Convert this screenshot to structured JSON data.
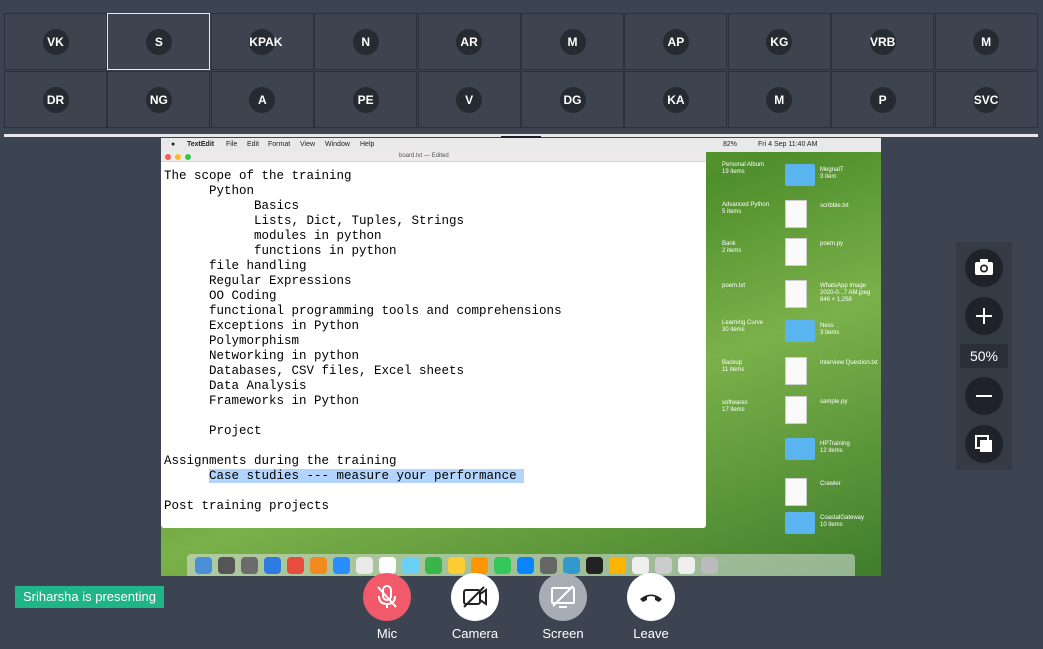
{
  "participants": {
    "row1": [
      "VK",
      "S",
      "KPAK",
      "N",
      "AR",
      "M",
      "AP",
      "KG",
      "VRB",
      "M"
    ],
    "row2": [
      "DR",
      "NG",
      "A",
      "PE",
      "V",
      "DG",
      "KA",
      "M",
      "P",
      "SVC"
    ],
    "active_index": 1
  },
  "shared_screen": {
    "menubar": {
      "app": "TextEdit",
      "menus": [
        "File",
        "Edit",
        "Format",
        "View",
        "Window",
        "Help"
      ],
      "battery": "82%",
      "datetime": "Fri 4 Sep  11:40 AM"
    },
    "editor": {
      "title": "board.txt",
      "title_suffix": "— Edited",
      "lines_before": "The scope of the training\n      Python\n            Basics\n            Lists, Dict, Tuples, Strings\n            modules in python\n            functions in python\n      file handling\n      Regular Expressions\n      OO Coding\n      functional programming tools and comprehensions\n      Exceptions in Python\n      Polymorphism\n      Networking in python\n      Databases, CSV files, Excel sheets\n      Data Analysis\n      Frameworks in Python\n\n      Project\n\nAssignments during the training\n      ",
      "highlighted": "Case studies --- measure your performance ",
      "lines_after": "\n\nPost training projects"
    },
    "desktop_items": [
      {
        "label": "Personal Album",
        "sub": "19 items"
      },
      {
        "label": "MegnaIT",
        "sub": "3 item"
      },
      {
        "label": "Advanced Python",
        "sub": "5 items"
      },
      {
        "label": "scribble.txt",
        "sub": ""
      },
      {
        "label": "Bank",
        "sub": "2 items"
      },
      {
        "label": "poem.py",
        "sub": ""
      },
      {
        "label": "poem.txt",
        "sub": ""
      },
      {
        "label": "WhatsApp Image 2020-0...7 AM.jpeg",
        "sub": "846 × 1,258"
      },
      {
        "label": "Learning Curve",
        "sub": "30 items"
      },
      {
        "label": "Ness",
        "sub": "3 items"
      },
      {
        "label": "Backup",
        "sub": "11 items"
      },
      {
        "label": "Interview Question.txt",
        "sub": ""
      },
      {
        "label": "softwares",
        "sub": "17 items"
      },
      {
        "label": "sample.py",
        "sub": ""
      },
      {
        "label": "HPTraining",
        "sub": "12 items"
      },
      {
        "label": "Crawler",
        "sub": ""
      },
      {
        "label": "CoastalGateway",
        "sub": "10 items"
      }
    ]
  },
  "zoom": {
    "value": "50%"
  },
  "presenting_badge": "Sriharsha is presenting",
  "controls": {
    "mic": "Mic",
    "camera": "Camera",
    "screen": "Screen",
    "leave": "Leave"
  },
  "colors": {
    "background": "#3c4452",
    "presenting_green": "#1fb586",
    "mic_red": "#f05a6b",
    "screen_gray": "#a8adb5"
  }
}
